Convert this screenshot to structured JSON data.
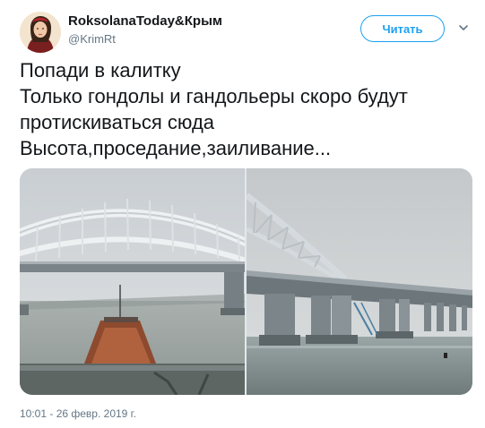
{
  "author": {
    "display_name": "RoksolanaToday&Крым",
    "handle": "@KrimRt",
    "avatar_icon": "avatar-portrait"
  },
  "follow_button": {
    "label": "Читать",
    "color": "#1da1f2"
  },
  "menu": {
    "icon": "chevron-down-icon"
  },
  "tweet": {
    "lines": [
      "Попади в калитку",
      "Только гондолы и гандольеры скоро будут",
      "протискиваться сюда",
      "Высота,проседание,заиливание..."
    ]
  },
  "media": {
    "photos": [
      {
        "name": "photo-arch-bridge-with-barge"
      },
      {
        "name": "photo-bridge-pillars-in-water"
      }
    ]
  },
  "timestamp": "10:01 - 26 февр. 2019 г.",
  "colors": {
    "text": "#14171a",
    "secondary": "#657786",
    "accent": "#1da1f2"
  }
}
